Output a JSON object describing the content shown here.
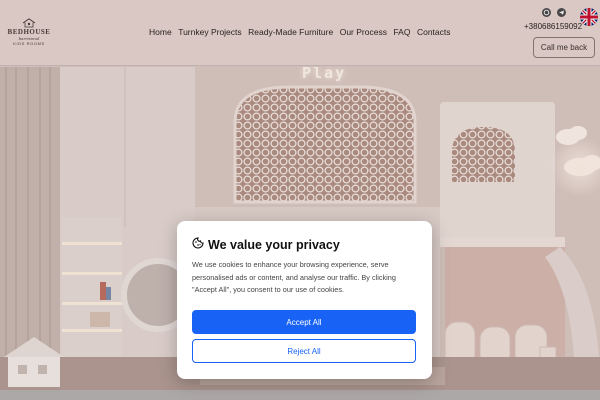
{
  "header": {
    "logo": {
      "brand": "BEDHOUSE",
      "tagline": "barrisimol",
      "subtitle": "KIDS ROOMS"
    },
    "nav": [
      "Home",
      "Turnkey Projects",
      "Ready-Made Furniture",
      "Our Process",
      "FAQ",
      "Contacts"
    ],
    "phone": "+380686159092",
    "call_button": "Call me back",
    "social_icons": [
      "viber-icon",
      "telegram-icon"
    ],
    "language_flag": "uk-flag-icon"
  },
  "hero": {
    "sign": "Play",
    "colors": {
      "wall": "#e8dcd6",
      "floor": "#b59f97",
      "light": "#fff6ec"
    }
  },
  "cookie_modal": {
    "title": "We value your privacy",
    "body": "We use cookies to enhance your browsing experience, serve personalised ads or content, and analyse our traffic. By clicking \"Accept All\", you consent to our use of cookies.",
    "accept_label": "Accept All",
    "reject_label": "Reject All",
    "accent": "#1862f5"
  }
}
